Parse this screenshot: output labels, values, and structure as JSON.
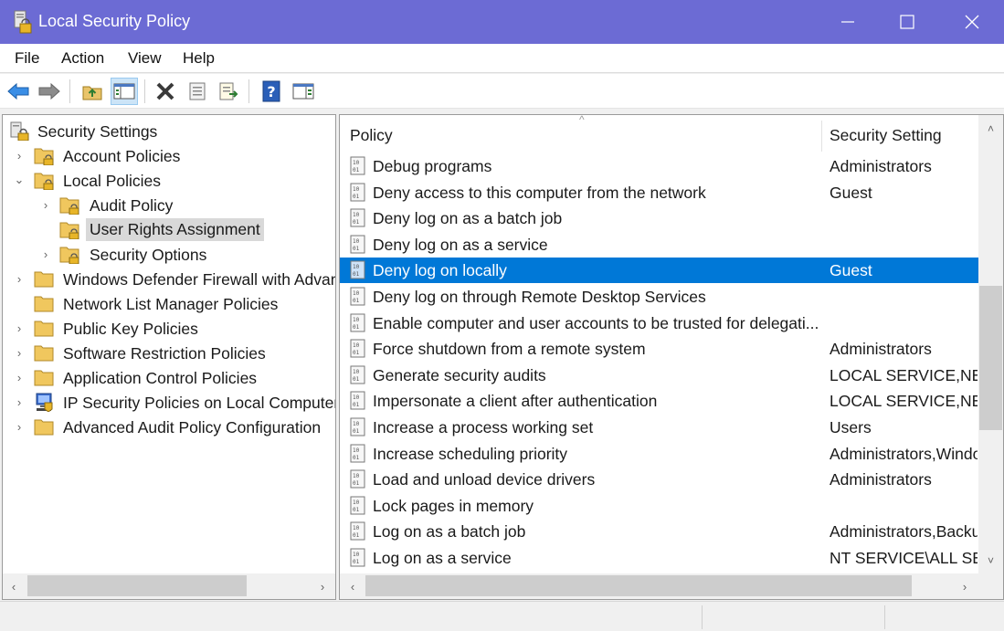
{
  "window": {
    "title": "Local Security Policy"
  },
  "menu": [
    "File",
    "Action",
    "View",
    "Help"
  ],
  "toolbar": [
    "back-icon",
    "forward-icon",
    "up-folder-icon",
    "show-hide-tree-icon",
    "delete-icon",
    "properties-icon",
    "export-list-icon",
    "help-icon",
    "show-action-pane-icon"
  ],
  "tree": [
    {
      "label": "Security Settings"
    },
    {
      "label": "Account Policies"
    },
    {
      "label": "Local Policies"
    },
    {
      "label": "Audit Policy"
    },
    {
      "label": "User Rights Assignment"
    },
    {
      "label": "Security Options"
    },
    {
      "label": "Windows Defender Firewall with Advanced Security"
    },
    {
      "label": "Network List Manager Policies"
    },
    {
      "label": "Public Key Policies"
    },
    {
      "label": "Software Restriction Policies"
    },
    {
      "label": "Application Control Policies"
    },
    {
      "label": "IP Security Policies on Local Computer"
    },
    {
      "label": "Advanced Audit Policy Configuration"
    }
  ],
  "list": {
    "columns": [
      "Policy",
      "Security Setting"
    ],
    "rows": [
      {
        "policy": "Debug programs",
        "setting": "Administrators"
      },
      {
        "policy": "Deny access to this computer from the network",
        "setting": "Guest"
      },
      {
        "policy": "Deny log on as a batch job",
        "setting": ""
      },
      {
        "policy": "Deny log on as a service",
        "setting": ""
      },
      {
        "policy": "Deny log on locally",
        "setting": "Guest"
      },
      {
        "policy": "Deny log on through Remote Desktop Services",
        "setting": ""
      },
      {
        "policy": "Enable computer and user accounts to be trusted for delegati...",
        "setting": ""
      },
      {
        "policy": "Force shutdown from a remote system",
        "setting": "Administrators"
      },
      {
        "policy": "Generate security audits",
        "setting": "LOCAL SERVICE,NETWORK SERVICE"
      },
      {
        "policy": "Impersonate a client after authentication",
        "setting": "LOCAL SERVICE,NETWORK SERVICE"
      },
      {
        "policy": "Increase a process working set",
        "setting": "Users"
      },
      {
        "policy": "Increase scheduling priority",
        "setting": "Administrators,Window Manager"
      },
      {
        "policy": "Load and unload device drivers",
        "setting": "Administrators"
      },
      {
        "policy": "Lock pages in memory",
        "setting": ""
      },
      {
        "policy": "Log on as a batch job",
        "setting": "Administrators,Backup Operators"
      },
      {
        "policy": "Log on as a service",
        "setting": "NT SERVICE\\ALL SERVICES"
      }
    ]
  },
  "colors": {
    "titlebar": "#6c6bd4",
    "selection": "#0078d7",
    "tree_selection": "#d9d9d9"
  }
}
